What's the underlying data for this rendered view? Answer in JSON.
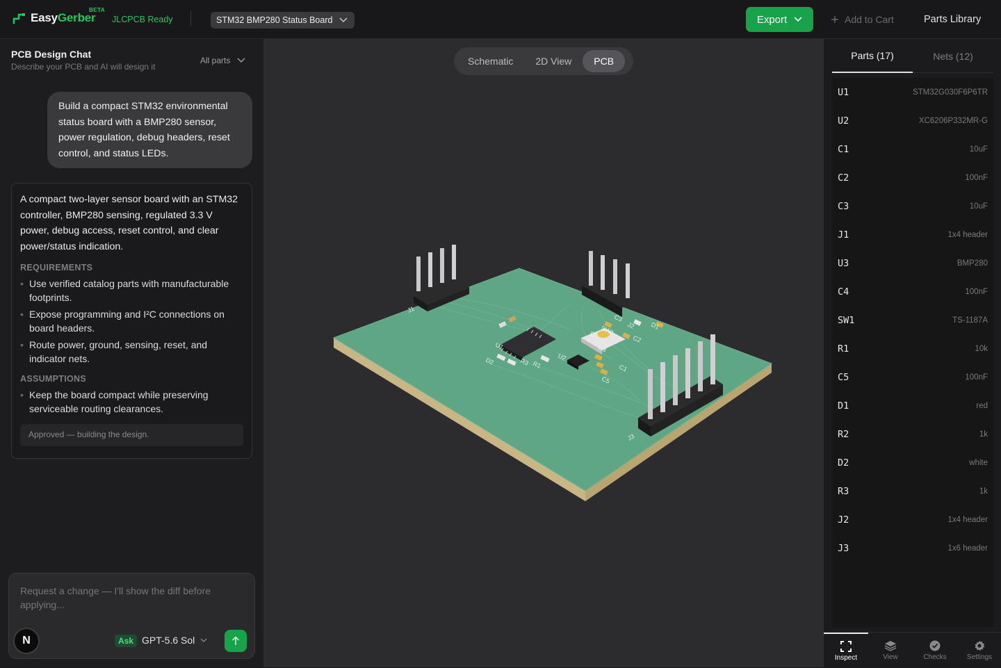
{
  "app": {
    "name_part1": "Easy",
    "name_part2": "Gerber",
    "beta": "BETA",
    "ready": "JLCPCB Ready"
  },
  "project": {
    "name": "STM32 BMP280 Status Board"
  },
  "actions": {
    "export": "Export",
    "add_to_cart": "Add to Cart",
    "parts_library": "Parts Library"
  },
  "chat": {
    "title": "PCB Design Chat",
    "subtitle": "Describe your PCB and AI will design it",
    "filter": "All parts",
    "user_message": "Build a compact STM32 environmental status board with a BMP280 sensor, power regulation, debug headers, reset control, and status LEDs.",
    "ai_intro": "A compact two-layer sensor board with an STM32 controller, BMP280 sensing, regulated 3.3 V power, debug access, reset control, and clear power/status indication.",
    "requirements_heading": "REQUIREMENTS",
    "requirements": [
      "Use verified catalog parts with manufacturable footprints.",
      "Expose programming and I²C connections on board headers.",
      "Route power, ground, sensing, reset, and indicator nets."
    ],
    "assumptions_heading": "ASSUMPTIONS",
    "assumptions": [
      "Keep the board compact while preserving serviceable routing clearances."
    ],
    "approved": "Approved — building the design.",
    "composer_placeholder": "Request a change — I'll show the diff before applying...",
    "avatar": "N",
    "mode": "Ask",
    "model": "GPT-5.6 Sol"
  },
  "viewport": {
    "tabs": [
      "Schematic",
      "2D View",
      "PCB"
    ],
    "active_tab": "PCB"
  },
  "silkscreen": [
    "J1",
    "J2",
    "J3",
    "U1",
    "U2",
    "U3",
    "C1",
    "C2",
    "C3",
    "C5",
    "R1",
    "R2",
    "R3",
    "D1",
    "D2",
    "SW1"
  ],
  "right": {
    "tabs": [
      "Parts (17)",
      "Nets (12)"
    ],
    "parts": [
      {
        "ref": "U1",
        "value": "STM32G030F6P6TR"
      },
      {
        "ref": "U2",
        "value": "XC6206P332MR-G"
      },
      {
        "ref": "C1",
        "value": "10uF"
      },
      {
        "ref": "C2",
        "value": "100nF"
      },
      {
        "ref": "C3",
        "value": "10uF"
      },
      {
        "ref": "J1",
        "value": "1x4 header"
      },
      {
        "ref": "U3",
        "value": "BMP280"
      },
      {
        "ref": "C4",
        "value": "100nF"
      },
      {
        "ref": "SW1",
        "value": "TS-1187A"
      },
      {
        "ref": "R1",
        "value": "10k"
      },
      {
        "ref": "C5",
        "value": "100nF"
      },
      {
        "ref": "D1",
        "value": "red"
      },
      {
        "ref": "R2",
        "value": "1k"
      },
      {
        "ref": "D2",
        "value": "white"
      },
      {
        "ref": "R3",
        "value": "1k"
      },
      {
        "ref": "J2",
        "value": "1x4 header"
      },
      {
        "ref": "J3",
        "value": "1x6 header"
      }
    ],
    "nav": [
      "Inspect",
      "View",
      "Checks",
      "Settings"
    ]
  },
  "colors": {
    "accent": "#16a34a",
    "board": "#5ea684",
    "board_edge": "#c8b684"
  }
}
